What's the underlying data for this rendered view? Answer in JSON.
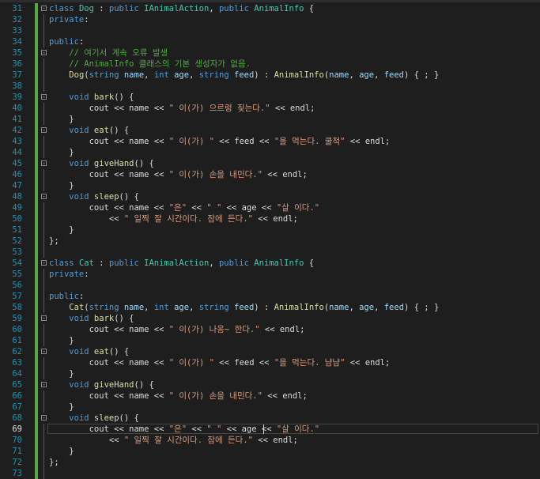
{
  "editor": {
    "current_line": 69,
    "lines": [
      {
        "n": 31,
        "fold": "-",
        "segs": [
          [
            "k",
            "class"
          ],
          [
            "",
            " "
          ],
          [
            "t",
            "Dog"
          ],
          [
            "",
            " : "
          ],
          [
            "k",
            "public"
          ],
          [
            "",
            " "
          ],
          [
            "t",
            "IAnimalAction"
          ],
          [
            "",
            ", "
          ],
          [
            "k",
            "public"
          ],
          [
            "",
            " "
          ],
          [
            "t",
            "AnimalInfo"
          ],
          [
            "",
            " {"
          ]
        ]
      },
      {
        "n": 32,
        "segs": [
          [
            "k",
            "private"
          ],
          [
            "",
            ":"
          ]
        ]
      },
      {
        "n": 33,
        "segs": []
      },
      {
        "n": 34,
        "segs": [
          [
            "k",
            "public"
          ],
          [
            "",
            ":"
          ]
        ]
      },
      {
        "n": 35,
        "fold": "-",
        "segs": [
          [
            "",
            "    "
          ],
          [
            "c",
            "// 여기서 계속 오류 발생"
          ]
        ]
      },
      {
        "n": 36,
        "segs": [
          [
            "",
            "    "
          ],
          [
            "c",
            "// AnimalInfo 클래스의 기본 생성자가 없음."
          ]
        ]
      },
      {
        "n": 37,
        "segs": [
          [
            "",
            "    "
          ],
          [
            "f",
            "Dog"
          ],
          [
            "",
            "("
          ],
          [
            "k",
            "string"
          ],
          [
            "",
            " "
          ],
          [
            "p",
            "name"
          ],
          [
            "",
            ", "
          ],
          [
            "k",
            "int"
          ],
          [
            "",
            " "
          ],
          [
            "p",
            "age"
          ],
          [
            "",
            ", "
          ],
          [
            "k",
            "string"
          ],
          [
            "",
            " "
          ],
          [
            "p",
            "feed"
          ],
          [
            "",
            ") : "
          ],
          [
            "f",
            "AnimalInfo"
          ],
          [
            "",
            "("
          ],
          [
            "p",
            "name"
          ],
          [
            "",
            ", "
          ],
          [
            "p",
            "age"
          ],
          [
            "",
            ", "
          ],
          [
            "p",
            "feed"
          ],
          [
            "",
            ") { ; }"
          ]
        ]
      },
      {
        "n": 38,
        "segs": []
      },
      {
        "n": 39,
        "fold": "-",
        "segs": [
          [
            "",
            "    "
          ],
          [
            "k",
            "void"
          ],
          [
            "",
            " "
          ],
          [
            "f",
            "bark"
          ],
          [
            "",
            "() {"
          ]
        ]
      },
      {
        "n": 40,
        "segs": [
          [
            "",
            "        cout << name << "
          ],
          [
            "s",
            "\" 이(가) 으르렁 짖는다.\""
          ],
          [
            "",
            " << endl;"
          ]
        ]
      },
      {
        "n": 41,
        "segs": [
          [
            "",
            "    }"
          ]
        ]
      },
      {
        "n": 42,
        "fold": "-",
        "segs": [
          [
            "",
            "    "
          ],
          [
            "k",
            "void"
          ],
          [
            "",
            " "
          ],
          [
            "f",
            "eat"
          ],
          [
            "",
            "() {"
          ]
        ]
      },
      {
        "n": 43,
        "segs": [
          [
            "",
            "        cout << name << "
          ],
          [
            "s",
            "\" 이(가) \""
          ],
          [
            "",
            " << feed << "
          ],
          [
            "s",
            "\"을 먹는다. 쿨척\""
          ],
          [
            "",
            " << endl;"
          ]
        ]
      },
      {
        "n": 44,
        "segs": [
          [
            "",
            "    }"
          ]
        ]
      },
      {
        "n": 45,
        "fold": "-",
        "segs": [
          [
            "",
            "    "
          ],
          [
            "k",
            "void"
          ],
          [
            "",
            " "
          ],
          [
            "f",
            "giveHand"
          ],
          [
            "",
            "() {"
          ]
        ]
      },
      {
        "n": 46,
        "segs": [
          [
            "",
            "        cout << name << "
          ],
          [
            "s",
            "\" 이(가) 손을 내민다.\""
          ],
          [
            "",
            " << endl;"
          ]
        ]
      },
      {
        "n": 47,
        "segs": [
          [
            "",
            "    }"
          ]
        ]
      },
      {
        "n": 48,
        "fold": "-",
        "segs": [
          [
            "",
            "    "
          ],
          [
            "k",
            "void"
          ],
          [
            "",
            " "
          ],
          [
            "f",
            "sleep"
          ],
          [
            "",
            "() {"
          ]
        ]
      },
      {
        "n": 49,
        "segs": [
          [
            "",
            "        cout << name << "
          ],
          [
            "s",
            "\"은\""
          ],
          [
            "",
            " << "
          ],
          [
            "s",
            "\" \""
          ],
          [
            "",
            " << age << "
          ],
          [
            "s",
            "\"살 이다.\""
          ]
        ]
      },
      {
        "n": 50,
        "segs": [
          [
            "",
            "            << "
          ],
          [
            "s",
            "\" 일찍 잘 시간이다. 잠에 든다.\""
          ],
          [
            "",
            " << endl;"
          ]
        ]
      },
      {
        "n": 51,
        "segs": [
          [
            "",
            "    }"
          ]
        ]
      },
      {
        "n": 52,
        "segs": [
          [
            "",
            "};"
          ]
        ]
      },
      {
        "n": 53,
        "segs": []
      },
      {
        "n": 54,
        "fold": "-",
        "segs": [
          [
            "k",
            "class"
          ],
          [
            "",
            " "
          ],
          [
            "t",
            "Cat"
          ],
          [
            "",
            " : "
          ],
          [
            "k",
            "public"
          ],
          [
            "",
            " "
          ],
          [
            "t",
            "IAnimalAction"
          ],
          [
            "",
            ", "
          ],
          [
            "k",
            "public"
          ],
          [
            "",
            " "
          ],
          [
            "t",
            "AnimalInfo"
          ],
          [
            "",
            " {"
          ]
        ]
      },
      {
        "n": 55,
        "segs": [
          [
            "k",
            "private"
          ],
          [
            "",
            ":"
          ]
        ]
      },
      {
        "n": 56,
        "segs": []
      },
      {
        "n": 57,
        "segs": [
          [
            "k",
            "public"
          ],
          [
            "",
            ":"
          ]
        ]
      },
      {
        "n": 58,
        "segs": [
          [
            "",
            "    "
          ],
          [
            "f",
            "Cat"
          ],
          [
            "",
            "("
          ],
          [
            "k",
            "string"
          ],
          [
            "",
            " "
          ],
          [
            "p",
            "name"
          ],
          [
            "",
            ", "
          ],
          [
            "k",
            "int"
          ],
          [
            "",
            " "
          ],
          [
            "p",
            "age"
          ],
          [
            "",
            ", "
          ],
          [
            "k",
            "string"
          ],
          [
            "",
            " "
          ],
          [
            "p",
            "feed"
          ],
          [
            "",
            ") : "
          ],
          [
            "f",
            "AnimalInfo"
          ],
          [
            "",
            "("
          ],
          [
            "p",
            "name"
          ],
          [
            "",
            ", "
          ],
          [
            "p",
            "age"
          ],
          [
            "",
            ", "
          ],
          [
            "p",
            "feed"
          ],
          [
            "",
            ") { ; }"
          ]
        ]
      },
      {
        "n": 59,
        "fold": "-",
        "segs": [
          [
            "",
            "    "
          ],
          [
            "k",
            "void"
          ],
          [
            "",
            " "
          ],
          [
            "f",
            "bark"
          ],
          [
            "",
            "() {"
          ]
        ]
      },
      {
        "n": 60,
        "segs": [
          [
            "",
            "        cout << name << "
          ],
          [
            "s",
            "\" 이(가) 나옹~ 한다.\""
          ],
          [
            "",
            " << endl;"
          ]
        ]
      },
      {
        "n": 61,
        "segs": [
          [
            "",
            "    }"
          ]
        ]
      },
      {
        "n": 62,
        "fold": "-",
        "segs": [
          [
            "",
            "    "
          ],
          [
            "k",
            "void"
          ],
          [
            "",
            " "
          ],
          [
            "f",
            "eat"
          ],
          [
            "",
            "() {"
          ]
        ]
      },
      {
        "n": 63,
        "segs": [
          [
            "",
            "        cout << name << "
          ],
          [
            "s",
            "\" 이(가) \""
          ],
          [
            "",
            " << feed << "
          ],
          [
            "s",
            "\"을 먹는다. 냠냠\""
          ],
          [
            "",
            " << endl;"
          ]
        ]
      },
      {
        "n": 64,
        "segs": [
          [
            "",
            "    }"
          ]
        ]
      },
      {
        "n": 65,
        "fold": "-",
        "segs": [
          [
            "",
            "    "
          ],
          [
            "k",
            "void"
          ],
          [
            "",
            " "
          ],
          [
            "f",
            "giveHand"
          ],
          [
            "",
            "() {"
          ]
        ]
      },
      {
        "n": 66,
        "segs": [
          [
            "",
            "        cout << name << "
          ],
          [
            "s",
            "\" 이(가) 손을 내민다.\""
          ],
          [
            "",
            " << endl;"
          ]
        ]
      },
      {
        "n": 67,
        "segs": [
          [
            "",
            "    }"
          ]
        ]
      },
      {
        "n": 68,
        "fold": "-",
        "segs": [
          [
            "",
            "    "
          ],
          [
            "k",
            "void"
          ],
          [
            "",
            " "
          ],
          [
            "f",
            "sleep"
          ],
          [
            "",
            "() {"
          ]
        ]
      },
      {
        "n": 69,
        "segs": [
          [
            "",
            "        cout << name << "
          ],
          [
            "s",
            "\"은\""
          ],
          [
            "",
            " << "
          ],
          [
            "s",
            "\" \""
          ],
          [
            "",
            " << age << "
          ],
          [
            "s",
            "\"살 이다.\""
          ]
        ]
      },
      {
        "n": 70,
        "segs": [
          [
            "",
            "            << "
          ],
          [
            "s",
            "\" 일찍 잘 시간이다. 잠에 든다.\""
          ],
          [
            "",
            " << endl;"
          ]
        ]
      },
      {
        "n": 71,
        "segs": [
          [
            "",
            "    }"
          ]
        ]
      },
      {
        "n": 72,
        "segs": [
          [
            "",
            "};"
          ]
        ]
      },
      {
        "n": 73,
        "segs": []
      }
    ]
  }
}
